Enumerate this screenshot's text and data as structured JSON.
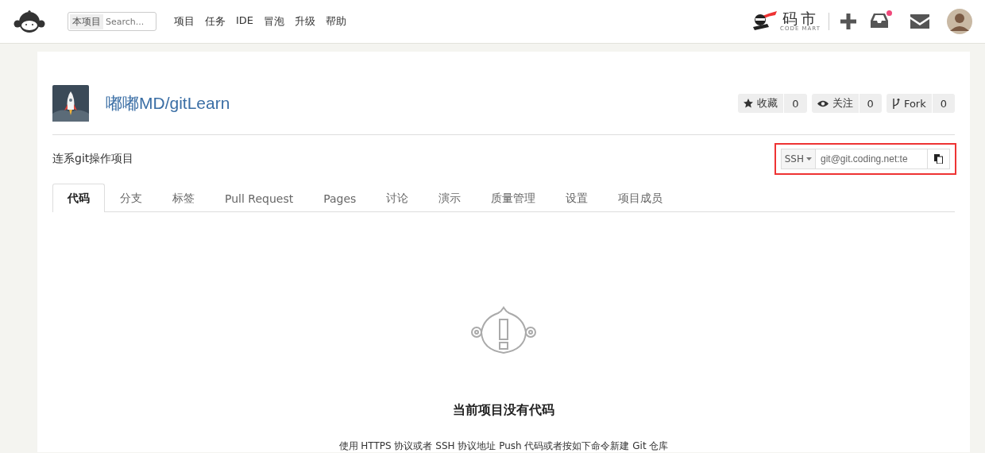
{
  "header": {
    "search": {
      "scope": "本项目",
      "placeholder": "Search..."
    },
    "nav": [
      "项目",
      "任务",
      "IDE",
      "冒泡",
      "升级",
      "帮助"
    ],
    "mart": {
      "name": "码市",
      "tagline": "CODE MART"
    },
    "inbox_unread": true
  },
  "repo": {
    "title": "嘟嘟MD/gitLearn",
    "description": "连系git操作项目",
    "actions": [
      {
        "kind": "star",
        "label": "收藏",
        "count": "0"
      },
      {
        "kind": "watch",
        "label": "关注",
        "count": "0"
      },
      {
        "kind": "fork",
        "label": "Fork",
        "count": "0"
      }
    ],
    "clone": {
      "protocol": "SSH",
      "url": "git@git.coding.net:te",
      "highlighted": true
    }
  },
  "tabs": [
    {
      "label": "代码",
      "selected": true
    },
    {
      "label": "分支",
      "selected": false
    },
    {
      "label": "标签",
      "selected": false
    },
    {
      "label": "Pull Request",
      "selected": false
    },
    {
      "label": "Pages",
      "selected": false
    },
    {
      "label": "讨论",
      "selected": false
    },
    {
      "label": "演示",
      "selected": false
    },
    {
      "label": "质量管理",
      "selected": false
    },
    {
      "label": "设置",
      "selected": false
    },
    {
      "label": "项目成员",
      "selected": false
    }
  ],
  "empty": {
    "title": "当前项目没有代码",
    "hint": "使用 HTTPS 协议或者 SSH 协议地址 Push 代码或者按如下命令新建 Git 仓库"
  }
}
